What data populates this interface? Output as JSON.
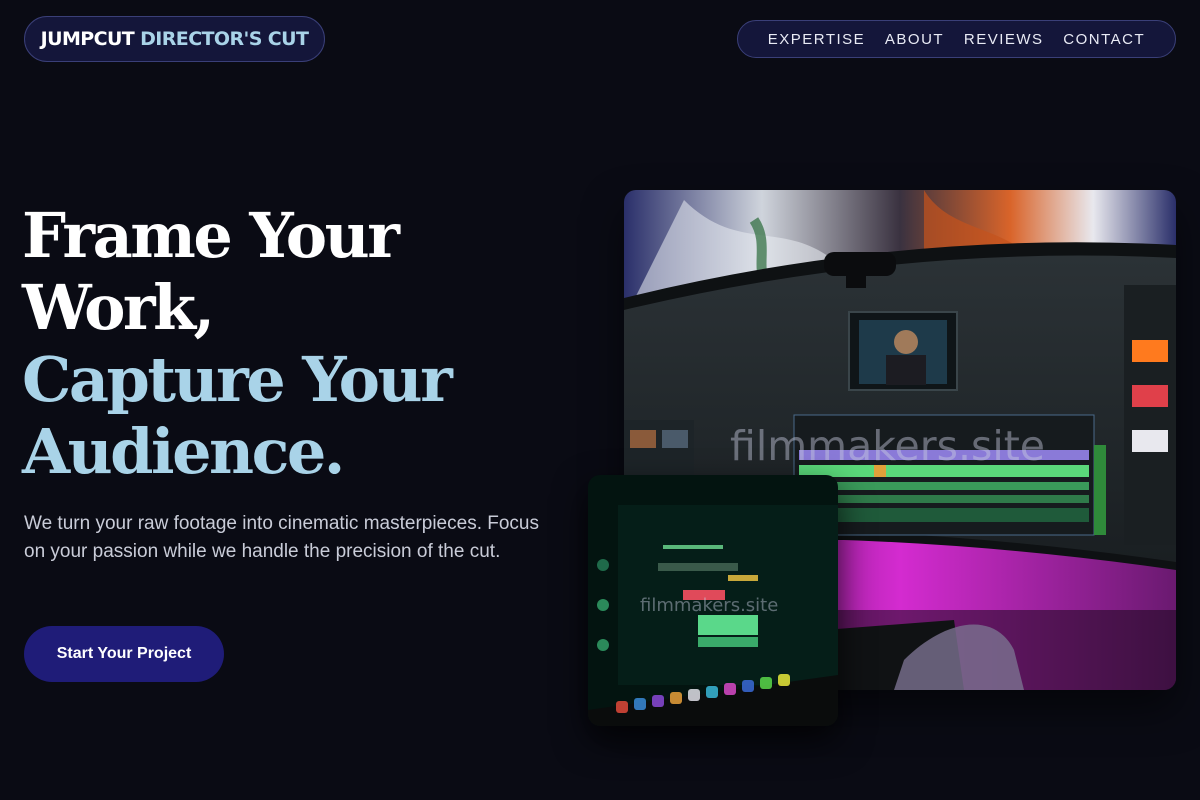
{
  "header": {
    "logo": {
      "brand": "JUMPCUT",
      "accent": "DIRECTOR'S CUT"
    },
    "nav": [
      {
        "label": "EXPERTISE"
      },
      {
        "label": "ABOUT"
      },
      {
        "label": "REVIEWS"
      },
      {
        "label": "CONTACT"
      }
    ]
  },
  "hero": {
    "headline": {
      "line1": "Frame Your",
      "line2": "Work,",
      "line3": "Capture Your",
      "line4": "Audience."
    },
    "subtext": "We turn your raw footage into cinematic masterpieces. Focus on your passion while we handle the precision of the cut.",
    "cta_label": "Start Your Project"
  },
  "images": {
    "main": {
      "watermark": "filmmakers.site"
    },
    "secondary": {
      "watermark": "filmmakers.site"
    }
  },
  "colors": {
    "background": "#0a0b14",
    "accent_text": "#a9d3e8",
    "cta_bg": "#1f1c78",
    "pill_bg": "#14163a",
    "pill_border": "#3a3f78"
  }
}
